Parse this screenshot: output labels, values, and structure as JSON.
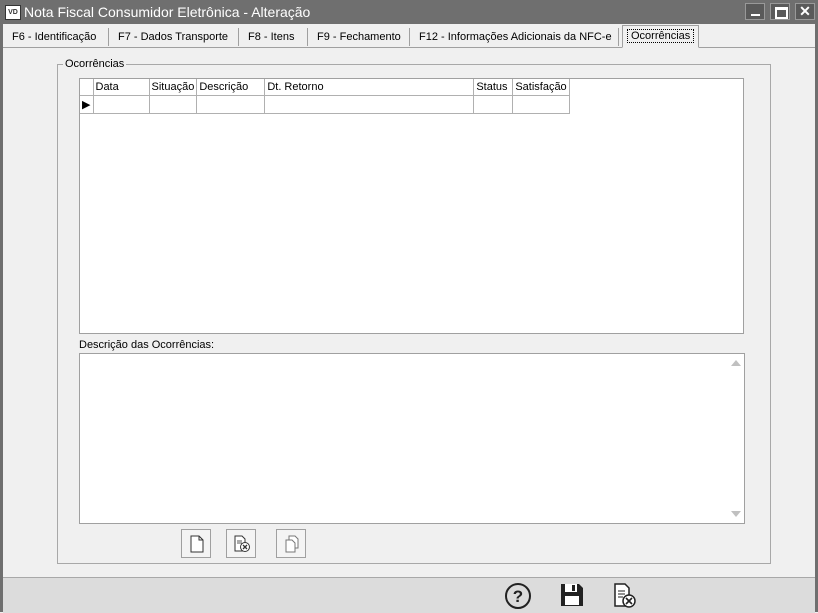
{
  "window": {
    "app_icon_text": "VD",
    "title": "Nota Fiscal Consumidor Eletrônica - Alteração",
    "minimize_icon": "minimize-icon",
    "maximize_icon": "maximize-icon",
    "close_icon": "close-icon",
    "close_glyph": "✕"
  },
  "tabs": [
    {
      "label": "F6 - Identificação",
      "active": false
    },
    {
      "label": "F7 - Dados Transporte",
      "active": false
    },
    {
      "label": "F8 - Itens",
      "active": false
    },
    {
      "label": "F9 - Fechamento",
      "active": false
    },
    {
      "label": "F12 - Informações Adicionais da NFC-e",
      "active": false
    },
    {
      "label": "Ocorrências",
      "active": true
    }
  ],
  "group": {
    "title": "Ocorrências"
  },
  "grid": {
    "columns": [
      "Data",
      "Situação",
      "Descrição",
      "Dt. Retorno",
      "Status",
      "Satisfação"
    ],
    "rows": [
      {
        "indicator": "▶",
        "cells": [
          "",
          "",
          "",
          "",
          "",
          ""
        ]
      }
    ]
  },
  "description": {
    "label": "Descrição das Ocorrências:",
    "value": ""
  },
  "toolbar": {
    "icons": [
      "new-document-icon",
      "delete-document-icon",
      "copy-document-icon"
    ]
  },
  "footer": {
    "icons": [
      "help-icon",
      "save-icon",
      "cancel-document-icon"
    ],
    "help_glyph": "?"
  }
}
